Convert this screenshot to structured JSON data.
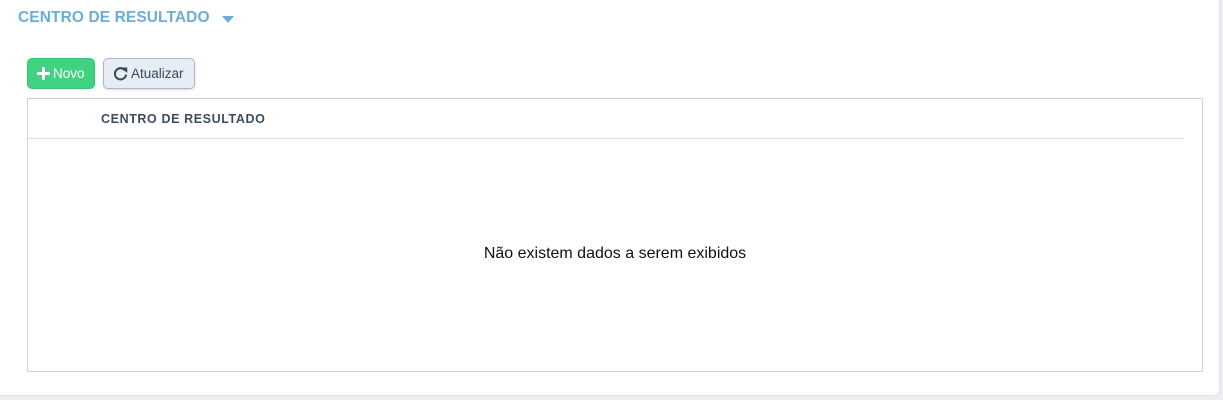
{
  "section": {
    "title": "CENTRO DE RESULTADO",
    "caret_icon": "caret-down-icon"
  },
  "toolbar": {
    "new_label": "Novo",
    "new_icon": "plus-icon",
    "refresh_label": "Atualizar",
    "refresh_icon": "refresh-icon"
  },
  "grid": {
    "columns": [
      "CENTRO DE RESULTADO"
    ],
    "rows": [],
    "empty_message": "Não existem dados a serem exibidos"
  },
  "colors": {
    "accent": "#6aaed6",
    "new_button": "#3fd381",
    "refresh_button": "#e7edf5"
  }
}
